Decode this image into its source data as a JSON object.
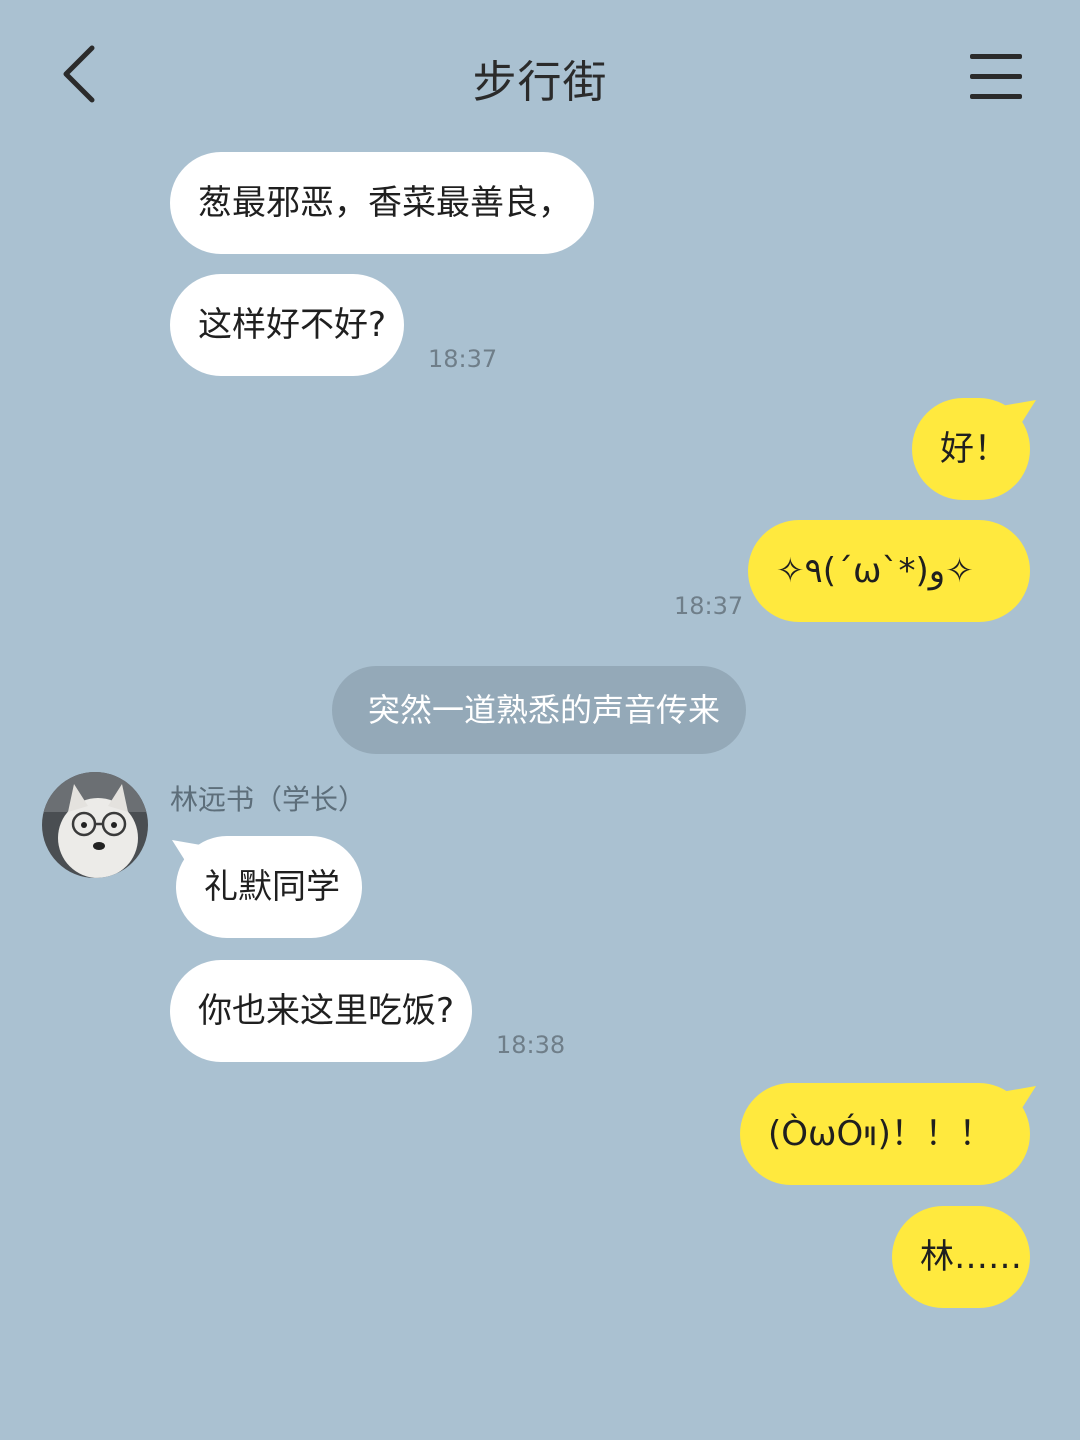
{
  "header": {
    "title": "步行街",
    "back_icon": "chevron-left-icon",
    "menu_icon": "hamburger-menu-icon"
  },
  "colors": {
    "background": "#aac1d1",
    "incoming_bubble": "#ffffff",
    "outgoing_bubble": "#ffe93e",
    "system_bubble": "#94a9b8"
  },
  "messages": {
    "m1": "葱最邪恶，香菜最善良，",
    "m2": "这样好不好?",
    "t1": "18:37",
    "m3": "好！",
    "m4": "✧٩(ˊωˋ*)و✧",
    "t2": "18:37",
    "system": "突然一道熟悉的声音传来",
    "sender": "林远书（学长）",
    "m5": "礼默同学",
    "m6": "你也来这里吃饭?",
    "t3": "18:38",
    "m7": "(ÒωÓױ)！！！",
    "m8": "林……"
  }
}
